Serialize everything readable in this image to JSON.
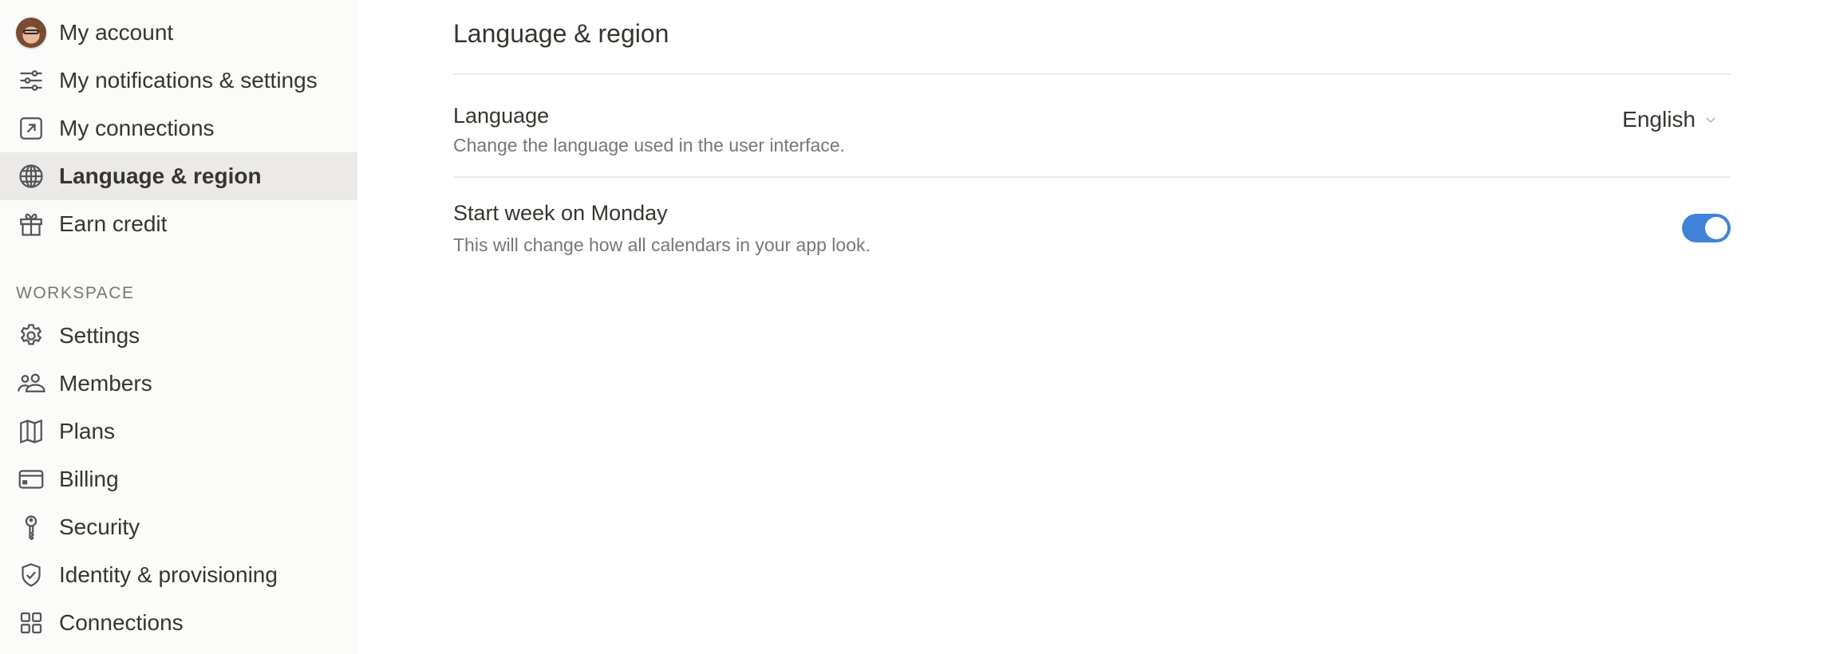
{
  "sidebar": {
    "account_items": [
      {
        "label": "My account",
        "icon": "avatar"
      },
      {
        "label": "My notifications & settings",
        "icon": "sliders-icon"
      },
      {
        "label": "My connections",
        "icon": "arrow-up-right-square-icon"
      },
      {
        "label": "Language & region",
        "icon": "globe-icon",
        "active": true
      },
      {
        "label": "Earn credit",
        "icon": "gift-icon"
      }
    ],
    "workspace_label": "WORKSPACE",
    "workspace_items": [
      {
        "label": "Settings",
        "icon": "gear-icon"
      },
      {
        "label": "Members",
        "icon": "people-icon"
      },
      {
        "label": "Plans",
        "icon": "map-icon"
      },
      {
        "label": "Billing",
        "icon": "credit-card-icon"
      },
      {
        "label": "Security",
        "icon": "key-icon"
      },
      {
        "label": "Identity & provisioning",
        "icon": "shield-check-icon"
      },
      {
        "label": "Connections",
        "icon": "grid-icon"
      }
    ]
  },
  "main": {
    "title": "Language & region",
    "settings": [
      {
        "title": "Language",
        "description": "Change the language used in the user interface.",
        "control": "dropdown",
        "value": "English"
      },
      {
        "title": "Start week on Monday",
        "description": "This will change how all calendars in your app look.",
        "control": "toggle",
        "value": true
      }
    ]
  },
  "colors": {
    "accent": "#3f84d9",
    "sidebar_bg": "#fbfbfa",
    "active_item_bg": "#ebeae8",
    "text": "#37352f",
    "muted_text": "#787774"
  }
}
